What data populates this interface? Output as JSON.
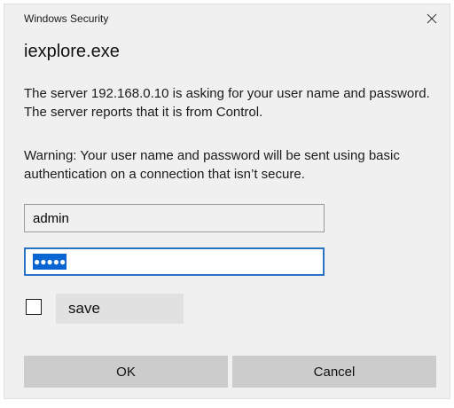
{
  "window": {
    "title": "Windows Security",
    "close_icon": "close-icon"
  },
  "dialog": {
    "app_name": "iexplore.exe",
    "message_1": "The server 192.168.0.10 is asking for your user name and password. The server reports that it is from Control.",
    "message_2": "Warning: Your user name and password will be sent using basic authentication on a connection that isn’t secure."
  },
  "form": {
    "username_value": "admin",
    "password_mask": "●●●●●",
    "remember_checked": false,
    "remember_label": "save"
  },
  "buttons": {
    "ok_label": "OK",
    "cancel_label": "Cancel"
  },
  "colors": {
    "dialog_bg": "#f0f0f0",
    "focus_border": "#2a73c4",
    "selection": "#0a64d2",
    "button_bg": "#cccccc"
  }
}
